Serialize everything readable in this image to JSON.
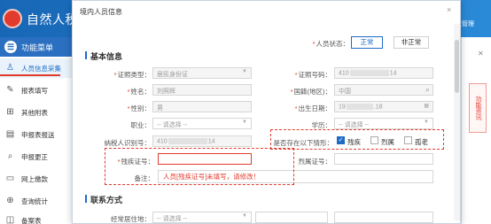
{
  "app": {
    "title": "自然人税收",
    "header_right": "业管理",
    "menu_title": "功能菜单"
  },
  "sidebar": {
    "items": [
      {
        "label": "人员信息采集",
        "icon": "person-icon",
        "glyph": "♙"
      },
      {
        "label": "报表填写",
        "icon": "edit-icon",
        "glyph": "✎"
      },
      {
        "label": "其他附表",
        "icon": "grid-icon",
        "glyph": "⊞"
      },
      {
        "label": "申报表报送",
        "icon": "document-icon",
        "glyph": "▤"
      },
      {
        "label": "申报更正",
        "icon": "search-icon",
        "glyph": "⌕"
      },
      {
        "label": "网上缴款",
        "icon": "window-icon",
        "glyph": "▭"
      },
      {
        "label": "查询统计",
        "icon": "stats-icon",
        "glyph": "⊕"
      },
      {
        "label": "备案表",
        "icon": "record-icon",
        "glyph": "◫"
      }
    ]
  },
  "right_panel": {
    "close": "✕",
    "tab_label": "功能资讯"
  },
  "modal": {
    "title": "境内人员信息",
    "close": "×",
    "status_label": "人员状态：",
    "status_options": [
      "正常",
      "非正常"
    ],
    "section_basic": "基本信息",
    "section_contact": "联系方式",
    "fields": {
      "id_type": {
        "label": "证照类型：",
        "value": "居民身份证"
      },
      "id_number": {
        "label": "证照号码：",
        "value_start": "410",
        "value_end": "14"
      },
      "name": {
        "label": "姓名：",
        "value": "刘照辉"
      },
      "nationality": {
        "label": "国籍(地区)：",
        "value": "中国"
      },
      "gender": {
        "label": "性别：",
        "value": "男"
      },
      "birth_date": {
        "label": "出生日期：",
        "value_start": "19",
        "value_end": ".18"
      },
      "occupation": {
        "label": "职业：",
        "value": "-- 请选择 --"
      },
      "education": {
        "label": "学历：",
        "value": "-- 请选择 --"
      },
      "taxpayer_id": {
        "label": "纳税人识别号：",
        "value_start": "410",
        "value_end": "14"
      },
      "special_status": {
        "label": "是否存在以下情形："
      },
      "disability_cert": {
        "label": "残疾证号：",
        "value": ""
      },
      "martyr_cert": {
        "label": "烈属证号：",
        "value": ""
      },
      "remark": {
        "label": "备注：",
        "value": ""
      },
      "residence": {
        "label": "经常居住地：",
        "value": "-- 请选择 --"
      }
    },
    "situations": [
      {
        "label": "残疾",
        "checked": true
      },
      {
        "label": "烈属",
        "checked": false
      },
      {
        "label": "孤老",
        "checked": false
      }
    ],
    "check_mark": "✓",
    "error_message": "人员[残疾证号]未填写，请修改！"
  },
  "colors": {
    "brand_blue": "#1f6cc6",
    "error_red": "#e23b2e",
    "header_blue": "#1767b6"
  }
}
